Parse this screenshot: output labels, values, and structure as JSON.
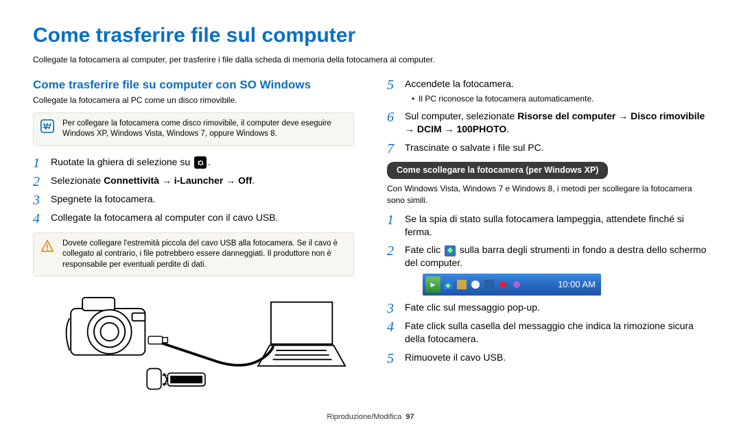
{
  "title": "Come trasferire file sul computer",
  "intro": "Collegate la fotocamera al computer, per trasferire i file dalla scheda di memoria della fotocamera al computer.",
  "left": {
    "heading": "Come trasferire file su computer con SO Windows",
    "sub": "Collegate la fotocamera al PC come un disco rimovibile.",
    "note": "Per collegare la fotocamera come disco rimovibile, il computer deve eseguire Windows XP, Windows Vista, Windows 7, oppure Windows 8.",
    "step1_a": "Ruotate la ghiera di selezione su ",
    "step1_b": ".",
    "step2_a": "Selezionate ",
    "step2_b": "Connettività → i-Launcher → Off",
    "step2_c": ".",
    "step3": "Spegnete la fotocamera.",
    "step4": "Collegate la fotocamera al computer con il cavo USB.",
    "warn": "Dovete collegare l'estremità piccola del cavo USB alla fotocamera. Se il cavo è collegato al contrario, i file potrebbero essere danneggiati. Il produttore non è responsabile per eventuali perdite di dati."
  },
  "right": {
    "step5": "Accendete la fotocamera.",
    "step5_bullet": "Il PC riconosce la fotocamera automaticamente.",
    "step6_a": "Sul computer, selezionate ",
    "step6_b": "Risorse del computer → Disco rimovibile → DCIM → 100PHOTO",
    "step6_c": ".",
    "step7": "Trascinate o salvate i file sul PC.",
    "pill": "Come scollegare la fotocamera (per Windows XP)",
    "pill_sub": "Con Windows Vista, Windows 7 e Windows 8, i metodi per scollegare la fotocamera sono simili.",
    "d1": "Se la spia di stato sulla fotocamera lampeggia, attendete finché si ferma.",
    "d2_a": "Fate clic ",
    "d2_b": " sulla barra degli strumenti in fondo a destra dello schermo del computer.",
    "taskbar_time": "10:00 AM",
    "d3": "Fate clic sul messaggio pop-up.",
    "d4": "Fate click sulla casella del messaggio che indica la rimozione sicura della fotocamera.",
    "d5": "Rimuovete il cavo USB."
  },
  "footer_section": "Riproduzione/Modifica",
  "footer_page": "97"
}
